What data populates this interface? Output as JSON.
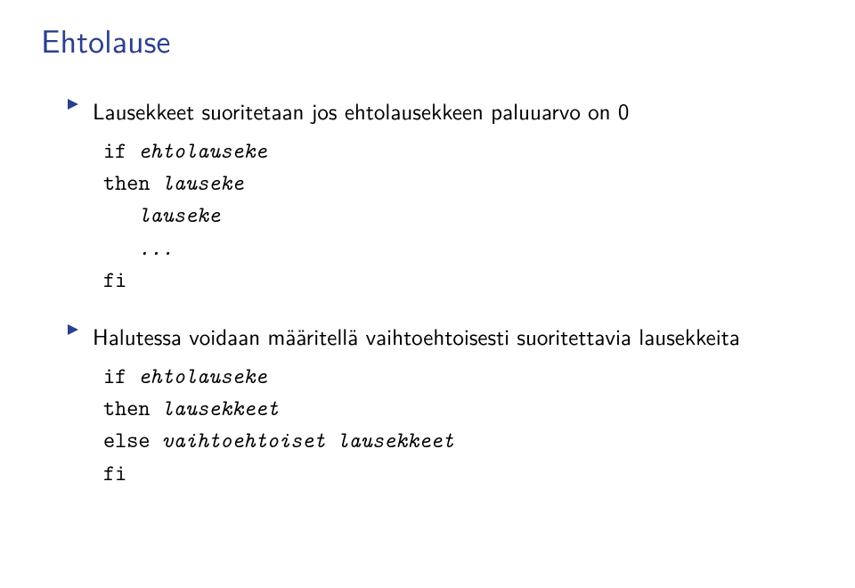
{
  "title": "Ehtolause",
  "bullets": [
    "Lausekkeet suoritetaan jos ehtolausekkeen paluuarvo on 0",
    "Halutessa voidaan määritellä vaihtoehtoisesti suoritettavia lausekkeita"
  ],
  "code1": {
    "l1_kw": "if",
    "l1_rest": " ehtolauseke",
    "l2_kw": "then",
    "l2_rest": " lauseke",
    "l3": "   lauseke",
    "l4": "   ...",
    "l5_kw": "fi"
  },
  "code2": {
    "l1_kw": "if",
    "l1_rest": " ehtolauseke",
    "l2_kw": "then",
    "l2_rest": " lausekkeet",
    "l3_kw": "else",
    "l3_rest": " vaihtoehtoiset lausekkeet",
    "l4_kw": "fi"
  }
}
